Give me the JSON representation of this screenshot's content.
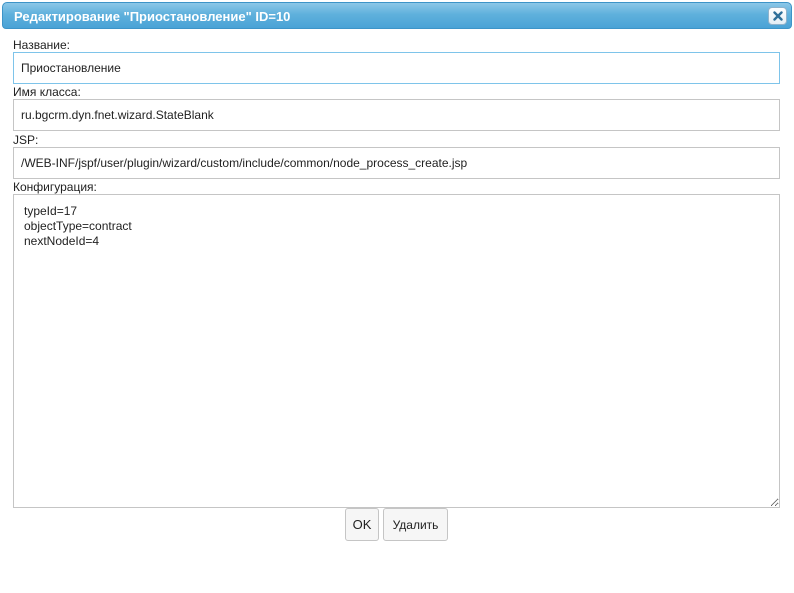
{
  "dialog": {
    "title": "Редактирование \"Приостановление\" ID=10"
  },
  "form": {
    "name_label": "Название:",
    "name_value": "Приостановление",
    "class_label": "Имя класса:",
    "class_value": "ru.bgcrm.dyn.fnet.wizard.StateBlank",
    "jsp_label": "JSP:",
    "jsp_value": "/WEB-INF/jspf/user/plugin/wizard/custom/include/common/node_process_create.jsp",
    "config_label": "Конфигурация:",
    "config_value": "typeId=17\nobjectType=contract\nnextNodeId=4"
  },
  "buttons": {
    "ok_label": "OK",
    "delete_label": "Удалить"
  },
  "icons": {
    "close": "close-icon"
  },
  "colors": {
    "titlebar": "#4aa3d6",
    "focus_border": "#7ec4ea"
  }
}
